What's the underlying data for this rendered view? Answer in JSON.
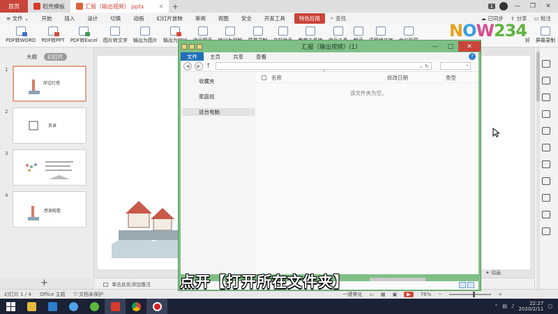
{
  "tabbar": {
    "home": "首页",
    "tabs": [
      {
        "label": "稻壳模板",
        "active": false
      },
      {
        "label": "汇报（输出视频）.pptx",
        "active": true
      }
    ],
    "plus": "+",
    "badge": "1"
  },
  "menubar": {
    "file": "文件",
    "items": [
      "开始",
      "插入",
      "设计",
      "切换",
      "动画",
      "幻灯片放映",
      "审阅",
      "视图",
      "安全",
      "开发工具"
    ],
    "special": "特色应用",
    "search": "查找",
    "right": [
      "已同步",
      "分享",
      "批注"
    ]
  },
  "ribbon": {
    "items": [
      "PDF转WORD",
      "PDF转PPT",
      "PDF转Excel",
      "图片转文字",
      "输出为图片",
      "输出为PDF",
      "演示图表",
      "输出为视频",
      "屏幕录制",
      "文档助手",
      "教学工具箱",
      "演示工具",
      "朗读",
      "语音转文字",
      "会议投屏"
    ],
    "right_items": [
      "好",
      "屏幕录制"
    ]
  },
  "watermark": {
    "c1": "N",
    "c2": "O",
    "c3": "W",
    "c4": "234"
  },
  "leftpanel": {
    "tabs": [
      "大纲",
      "幻灯片"
    ],
    "slides": [
      {
        "num": "1",
        "title": "岸边灯塔"
      },
      {
        "num": "2",
        "title": "目录"
      },
      {
        "num": "3",
        "title": ""
      },
      {
        "num": "4",
        "title": "感谢观看"
      }
    ],
    "add": "+"
  },
  "notes": {
    "placeholder": "单击此处添加备注"
  },
  "canvas_right": {
    "animation": "动画"
  },
  "statusbar": {
    "slide": "幻灯片 1 / 4",
    "theme": "Office 主题",
    "protect": "文档未保护",
    "beautify": "一键美化",
    "zoom": "76%"
  },
  "taskbar": {
    "time": "22:27",
    "date": "2020/2/11"
  },
  "explorer": {
    "title": "汇报（输出视频）(1)",
    "menu": [
      "文件",
      "主页",
      "共享",
      "查看"
    ],
    "help": "?",
    "nav": [
      "收藏夹",
      "家庭组",
      "这台电脑"
    ],
    "columns": [
      "名称",
      "修改日期",
      "类型"
    ],
    "empty": "该文件夹为空。"
  },
  "subtitle": "点开【打开所在文件夹】"
}
